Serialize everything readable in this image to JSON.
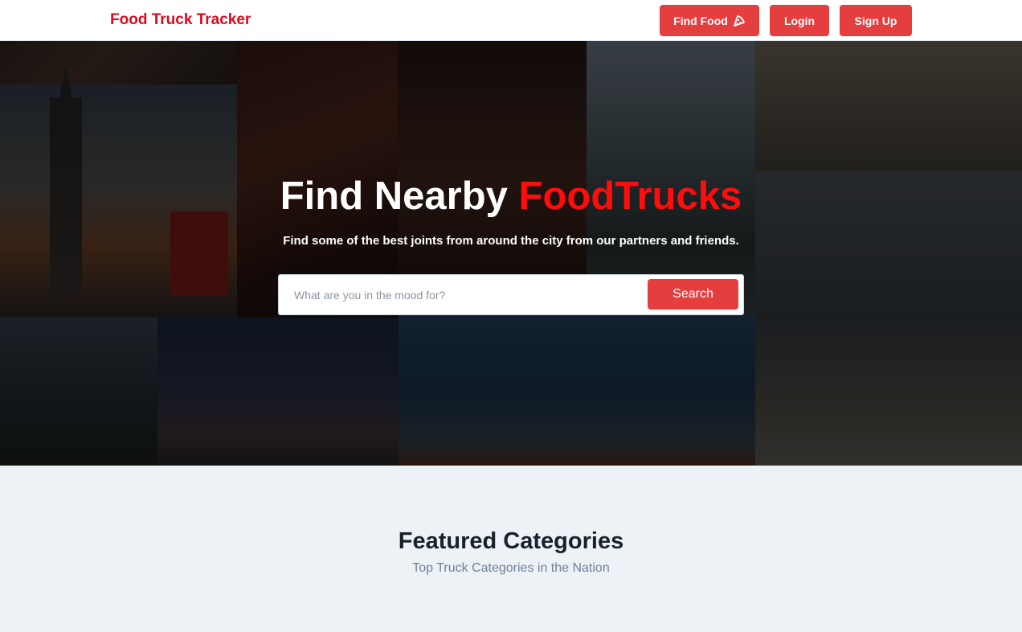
{
  "navbar": {
    "brand": "Food Truck Tracker",
    "find_food_label": "Find Food",
    "login_label": "Login",
    "signup_label": "Sign Up",
    "find_food_icon": "pizza-slice-icon"
  },
  "hero": {
    "title_prefix": "Find Nearby ",
    "title_accent": "FoodTrucks",
    "subtitle": "Find some of the best joints from around the city from our partners and friends.",
    "search_placeholder": "What are you in the mood for?",
    "search_value": "",
    "search_button": "Search"
  },
  "featured": {
    "title": "Featured Categories",
    "subtitle": "Top Truck Categories in the Nation"
  },
  "colors": {
    "brand": "#e3061c",
    "button": "#e53e3e",
    "accent_text": "#ff0c0c",
    "section_bg": "#edf2f7"
  }
}
